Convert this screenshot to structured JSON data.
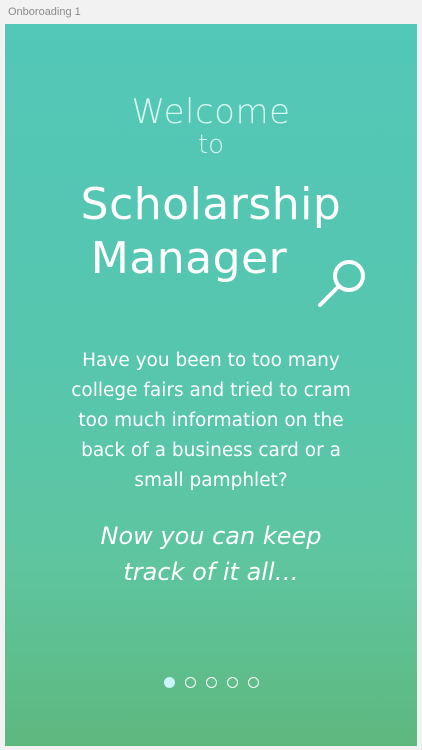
{
  "artboard": {
    "label": "Onboroading 1"
  },
  "onboarding": {
    "welcome_line1": "Welcome",
    "welcome_line2": "to",
    "app_title_line1": "Scholarship",
    "app_title_line2": "Manager",
    "intro_text": "Have you been to too many college fairs and tried to cram too much information on the back of a business card or a small pamphlet?",
    "tagline_line1": "Now you can keep",
    "tagline_line2": "track of it all…",
    "title_icon": "magnifying-glass-icon",
    "pager": {
      "total_pages": 5,
      "current_page": 1
    }
  },
  "colors": {
    "gradient_top": "#53c7b8",
    "gradient_bottom": "#5eb87e",
    "text": "#ffffff",
    "active_dot": "#c9f5f6"
  }
}
